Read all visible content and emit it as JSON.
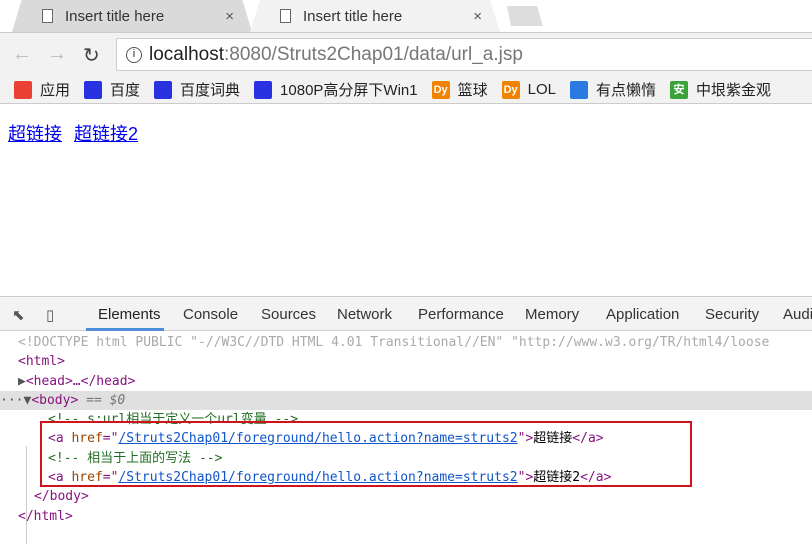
{
  "tabs": [
    {
      "title": "Insert title here",
      "active": false
    },
    {
      "title": "Insert title here",
      "active": true
    }
  ],
  "address": {
    "host": "localhost",
    "rest": ":8080/Struts2Chap01/data/url_a.jsp"
  },
  "bookmarks": [
    {
      "label": "应用",
      "icon": "apps-grid-icon",
      "color": "#e94235"
    },
    {
      "label": "百度",
      "icon": "baidu-paw-icon",
      "color": "#2932e1"
    },
    {
      "label": "百度词典",
      "icon": "baidu-paw-icon",
      "color": "#2932e1"
    },
    {
      "label": "1080P高分屏下Win1",
      "icon": "baidu-paw-icon",
      "color": "#2932e1"
    },
    {
      "label": "篮球",
      "icon": "dy-icon",
      "color": "#f08300"
    },
    {
      "label": "LOL",
      "icon": "dy-icon",
      "color": "#f08300"
    },
    {
      "label": "有点懒惰",
      "icon": "circle-icon",
      "color": "#2a7ae2"
    },
    {
      "label": "中垠紫金观",
      "icon": "an-icon",
      "color": "#3aa33a"
    }
  ],
  "page": {
    "links": [
      "超链接",
      "超链接2"
    ]
  },
  "devtools": {
    "tabs": [
      "Elements",
      "Console",
      "Sources",
      "Network",
      "Performance",
      "Memory",
      "Application",
      "Security",
      "Audi"
    ],
    "lines": {
      "doctype": "<!DOCTYPE html PUBLIC \"-//W3C//DTD HTML 4.01 Transitional//EN\" \"http://www.w3.org/TR/html4/loose",
      "html_open": "<html>",
      "head": "<head>…</head>",
      "body_open": "<body>",
      "body_eq": " == $0",
      "comment1": "<!-- s:url相当于定义一个url变量 -->",
      "a_href": "/Struts2Chap01/foreground/hello.action?name=struts2",
      "a1_text": "超链接",
      "comment2": "<!-- 相当于上面的写法 -->",
      "a2_text": "超链接2",
      "body_close": "</body>",
      "html_close": "</html>"
    }
  },
  "highlight_color": "#d0121b"
}
